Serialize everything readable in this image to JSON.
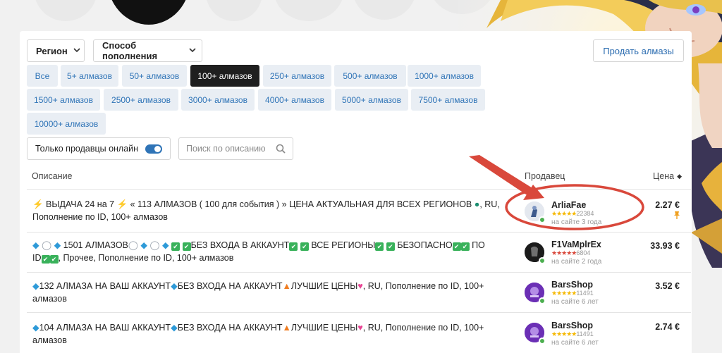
{
  "toolbar": {
    "region_label": "Регион",
    "method_label": "Способ пополнения",
    "sell_button": "Продать алмазы"
  },
  "amount_filters": [
    {
      "label": "Все",
      "active": false
    },
    {
      "label": "5+ алмазов",
      "active": false
    },
    {
      "label": "50+ алмазов",
      "active": false
    },
    {
      "label": "100+ алмазов",
      "active": true
    },
    {
      "label": "250+ алмазов",
      "active": false
    },
    {
      "label": "500+ алмазов",
      "active": false
    },
    {
      "label": "1000+ алмазов",
      "active": false
    },
    {
      "label": "1500+ алмазов",
      "active": false
    },
    {
      "label": "2500+ алмазов",
      "active": false
    },
    {
      "label": "3000+ алмазов",
      "active": false
    },
    {
      "label": "4000+ алмазов",
      "active": false
    },
    {
      "label": "5000+ алмазов",
      "active": false
    },
    {
      "label": "7500+ алмазов",
      "active": false
    },
    {
      "label": "10000+ алмазов",
      "active": false
    }
  ],
  "online_only": {
    "label": "Только продавцы онлайн",
    "enabled": true
  },
  "search": {
    "placeholder": "Поиск по описанию"
  },
  "table": {
    "col_description": "Описание",
    "col_seller": "Продавец",
    "col_price": "Цена"
  },
  "offers": [
    {
      "line1_a": " ВЫДАЧА 24 на 7 ",
      "line1_b": " « 113 АЛМАЗОВ ( 100 для события ) » ЦЕНА АКТУАЛЬНАЯ ДЛЯ ВСЕХ РЕГИОНОВ ",
      "line1_c": ", RU,",
      "line2": "Пополнение по ID, 100+ алмазов",
      "seller": "ArliaFae",
      "reviews": "22384",
      "tenure": "на сайте 3 года",
      "price": "2.27 €",
      "pinned": true,
      "star_color": "#f5b800"
    },
    {
      "line1_a": "1501 АЛМАЗОВ",
      "line1_b": "БЕЗ ВХОДА В АККАУНТ",
      "line1_c": "ВСЕ РЕГИОНЫ",
      "line1_d": "БЕЗОПАСНО",
      "line1_e": "ПО",
      "line2_a": "ID",
      "line2_b": ", Прочее, Пополнение по ID, 100+ алмазов",
      "seller": "F1VaMplrEx",
      "reviews": "6804",
      "tenure": "на сайте 2 года",
      "price": "33.93 €",
      "pinned": false,
      "star_color": "#d9483b"
    },
    {
      "text_a": "132 АЛМАЗА НА ВАШ АККАУНТ",
      "text_b": "БЕЗ ВХОДА НА АККАУНТ",
      "text_c": "ЛУЧШИЕ ЦЕНЫ",
      "text_d": ", RU, Пополнение по ID, 100+ алмазов",
      "seller": "BarsShop",
      "reviews": "11491",
      "tenure": "на сайте 6 лет",
      "price": "3.52 €",
      "pinned": false,
      "star_color": "#f5b800"
    },
    {
      "text_a": "104 АЛМАЗА НА ВАШ АККАУНТ",
      "text_b": "БЕЗ ВХОДА НА АККАУНТ",
      "text_c": "ЛУЧШИЕ ЦЕНЫ",
      "text_d": ", RU, Пополнение по ID, 100+ алмазов",
      "seller": "BarsShop",
      "reviews": "11491",
      "tenure": "на сайте 6 лет",
      "price": "2.74 €",
      "pinned": false,
      "star_color": "#f5b800"
    }
  ],
  "icons": {
    "bolt": "⚡",
    "globe": "🌍",
    "diamond": "💎",
    "ring": "💍",
    "check": "✔",
    "fire": "🔥",
    "heart": "💯",
    "pin": "📌",
    "search": "search-icon"
  },
  "colors": {
    "accent": "#2f74b7",
    "chip_bg": "#e9eef4",
    "active_chip": "#1f1f1f",
    "annotation": "#d9483b",
    "online": "#4caf50"
  }
}
